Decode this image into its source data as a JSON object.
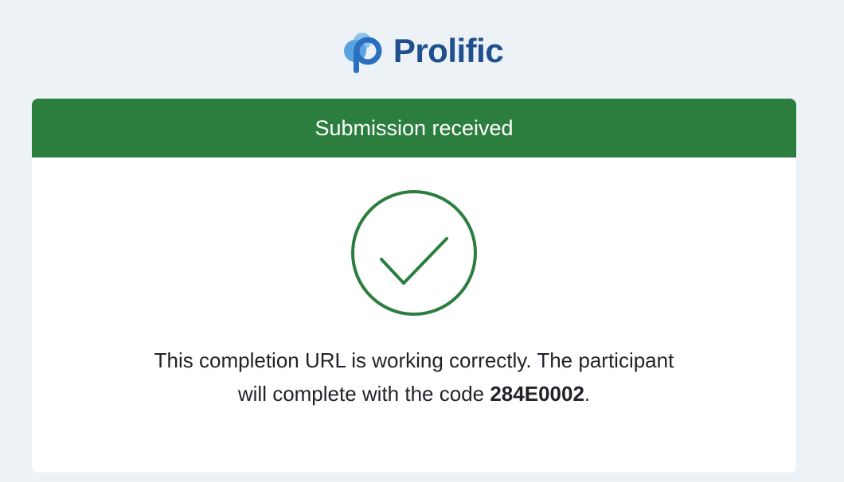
{
  "brand": {
    "name": "Prolific",
    "logo_icon": "prolific-logo-icon"
  },
  "colors": {
    "background": "#edf2f6",
    "brand_blue": "#1f4f8f",
    "success_green": "#2b7e3e"
  },
  "card": {
    "header_title": "Submission received",
    "icon": "check-circle-icon",
    "message_line1": "This completion URL is working correctly. The participant",
    "message_line2_prefix": "will complete with the code ",
    "completion_code": "284E0002",
    "message_line2_suffix": "."
  }
}
